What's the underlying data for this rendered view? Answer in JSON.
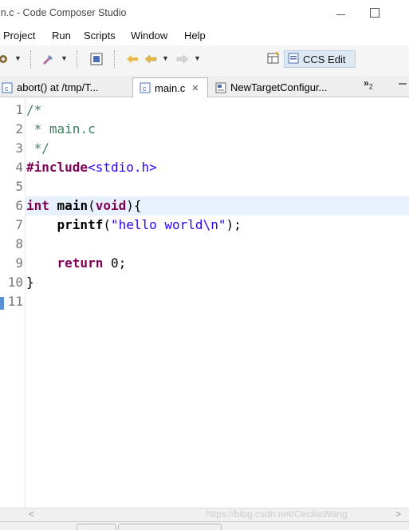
{
  "window": {
    "title": "in.c - Code Composer Studio"
  },
  "menu": [
    "Project",
    "Run",
    "Scripts",
    "Window",
    "Help"
  ],
  "toolbar": {
    "perspective_label": "CCS Edit"
  },
  "tabs": [
    {
      "label": "abort() at /tmp/T...",
      "active": false
    },
    {
      "label": "main.c",
      "active": true,
      "close": "✕"
    },
    {
      "label": "NewTargetConfigur...",
      "active": false
    }
  ],
  "tab_overflow": {
    "symbol": "»",
    "count": "2"
  },
  "editor": {
    "lines": [
      {
        "n": "1",
        "parts": [
          {
            "t": "/*",
            "c": "cm"
          }
        ]
      },
      {
        "n": "2",
        "parts": [
          {
            "t": " * main.c",
            "c": "cm"
          }
        ]
      },
      {
        "n": "3",
        "parts": [
          {
            "t": " */",
            "c": "cm"
          }
        ]
      },
      {
        "n": "4",
        "parts": [
          {
            "t": "#include",
            "c": "pre"
          },
          {
            "t": "<stdio.h>",
            "c": "inc"
          }
        ]
      },
      {
        "n": "5",
        "parts": []
      },
      {
        "n": "6",
        "parts": [
          {
            "t": "int",
            "c": "kw"
          },
          {
            "t": " ",
            "c": ""
          },
          {
            "t": "main",
            "c": "fn"
          },
          {
            "t": "(",
            "c": ""
          },
          {
            "t": "void",
            "c": "kw"
          },
          {
            "t": "){",
            "c": ""
          }
        ]
      },
      {
        "n": "7",
        "parts": [
          {
            "t": "    ",
            "c": ""
          },
          {
            "t": "printf",
            "c": "fn"
          },
          {
            "t": "(",
            "c": ""
          },
          {
            "t": "\"hello world\\n\"",
            "c": "str"
          },
          {
            "t": ");",
            "c": ""
          }
        ]
      },
      {
        "n": "8",
        "parts": []
      },
      {
        "n": "9",
        "parts": [
          {
            "t": "    ",
            "c": ""
          },
          {
            "t": "return",
            "c": "kw"
          },
          {
            "t": " 0;",
            "c": ""
          }
        ]
      },
      {
        "n": "10",
        "parts": [
          {
            "t": "}",
            "c": ""
          }
        ]
      },
      {
        "n": "11",
        "parts": []
      }
    ]
  },
  "scrollbar": {
    "left": "<",
    "right": ">"
  },
  "watermark": "https://blog.csdn.net/CeciliaWang",
  "colors": {
    "accent": "#dde8f3",
    "current_line": "#e8f2fe",
    "keyword": "#7f0055",
    "comment": "#3f7f5f",
    "string": "#2a00ff"
  }
}
